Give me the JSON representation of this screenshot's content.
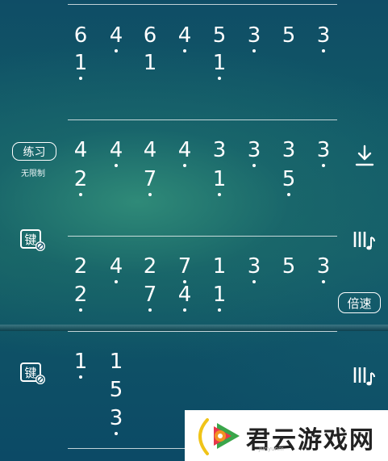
{
  "toolbar": {
    "practice_label": "练习",
    "no_limit_label": "无限制",
    "speed_label": "倍速",
    "download_icon": "download-icon",
    "keyboard_icon": "keyboard-icon",
    "score_icon": "score-music-icon"
  },
  "score": {
    "block1": {
      "treble": [
        "6",
        "4",
        "6",
        "4",
        "5",
        "3",
        "5",
        "3"
      ],
      "bass": [
        "1",
        "1",
        "1"
      ]
    },
    "block2": {
      "treble": [
        "4",
        "4",
        "4",
        "4",
        "3",
        "3",
        "3",
        "3"
      ],
      "bass": [
        "2",
        "7",
        "1",
        "5"
      ]
    },
    "block3": {
      "treble": [
        "2",
        "4",
        "2",
        "7",
        "1",
        "3",
        "5",
        "3"
      ],
      "bass": [
        "2",
        "7",
        "4",
        "1"
      ]
    },
    "block4": {
      "col1": [
        "1"
      ],
      "col2": [
        "1",
        "5",
        "3"
      ]
    }
  },
  "watermark": {
    "title": "君云游戏网",
    "subtitle": "Junyunm"
  }
}
